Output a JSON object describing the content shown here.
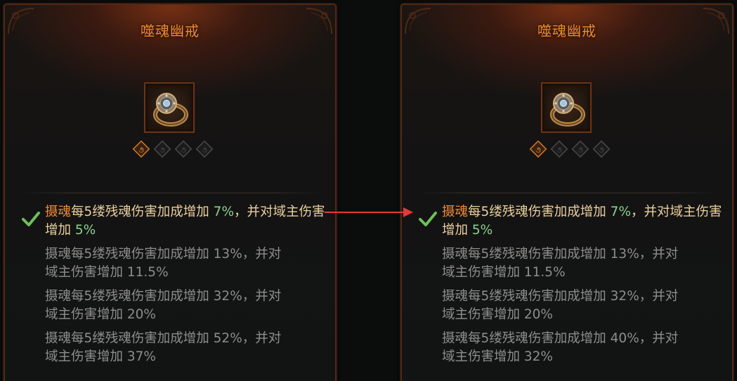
{
  "panels": [
    {
      "title": "噬魂幽戒",
      "icon": "ring-icon",
      "sockets": [
        "socket-filled-icon",
        "socket-empty-icon",
        "socket-empty-icon",
        "socket-empty-icon"
      ],
      "affixes": [
        {
          "keyword": "摄魂",
          "text1": "每5缕残魂伤害加成增加 ",
          "val1": "7%",
          "text2": "，并对域主伤害增加 ",
          "val2": "5%"
        },
        {
          "line1": "摄魂每5缕残魂伤害加成增加 13%，并对",
          "line2": "域主伤害增加 11.5%"
        },
        {
          "line1": "摄魂每5缕残魂伤害加成增加 32%，并对",
          "line2": "域主伤害增加 20%"
        },
        {
          "line1": "摄魂每5缕残魂伤害加成增加 52%，并对",
          "line2": "域主伤害增加 37%"
        }
      ]
    },
    {
      "title": "噬魂幽戒",
      "icon": "ring-icon",
      "sockets": [
        "socket-filled-icon",
        "socket-empty-icon",
        "socket-empty-icon",
        "socket-empty-icon"
      ],
      "affixes": [
        {
          "keyword": "摄魂",
          "text1": "每5缕残魂伤害加成增加 ",
          "val1": "7%",
          "text2": "，并对域主伤害增加 ",
          "val2": "5%"
        },
        {
          "line1": "摄魂每5缕残魂伤害加成增加 13%，并对",
          "line2": "域主伤害增加 11.5%"
        },
        {
          "line1": "摄魂每5缕残魂伤害加成增加 32%，并对",
          "line2": "域主伤害增加 20%"
        },
        {
          "line1": "摄魂每5缕残魂伤害加成增加 40%，并对",
          "line2": "域主伤害增加 32%"
        }
      ]
    }
  ],
  "colors": {
    "title": "#f08a2e",
    "keyword": "#f0893a",
    "active_text": "#e9cf9c",
    "value_green": "#8bd08d",
    "inactive_text": "#8d8e8c",
    "arrow": "#e53935",
    "check": "#6fbf5a"
  }
}
